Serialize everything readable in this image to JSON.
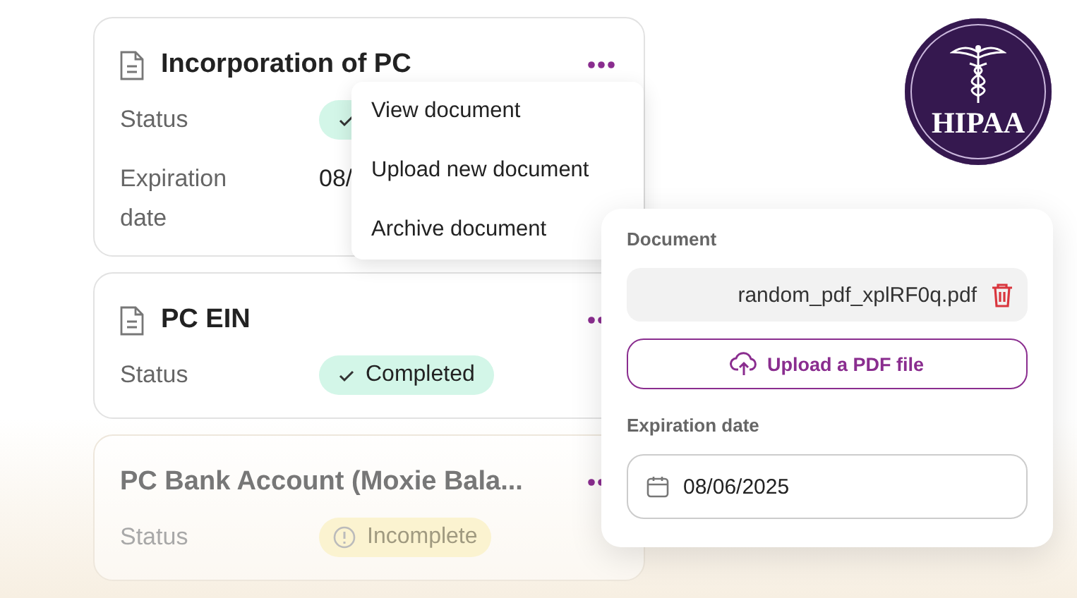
{
  "cards": [
    {
      "title": "Incorporation of PC",
      "has_file_icon": true,
      "faded": false,
      "status": {
        "kind": "completed"
      },
      "expiration": {
        "label": "Expiration date",
        "value": "08/"
      },
      "status_label": "Status"
    },
    {
      "title": "PC EIN",
      "has_file_icon": true,
      "faded": false,
      "status": {
        "kind": "completed",
        "label": "Completed"
      },
      "status_label": "Status"
    },
    {
      "title": "PC Bank Account (Moxie Bala...",
      "has_file_icon": false,
      "faded": true,
      "status": {
        "kind": "incomplete",
        "label": "Incomplete"
      },
      "status_label": "Status"
    }
  ],
  "menu": {
    "items": [
      "View document",
      "Upload new document",
      "Archive document"
    ]
  },
  "popover": {
    "document_label": "Document",
    "filename": "random_pdf_xplRF0q.pdf",
    "upload_button": "Upload a PDF file",
    "expiration_label": "Expiration date",
    "date": "08/06/2025"
  },
  "badge": {
    "text": "HIPAA"
  }
}
